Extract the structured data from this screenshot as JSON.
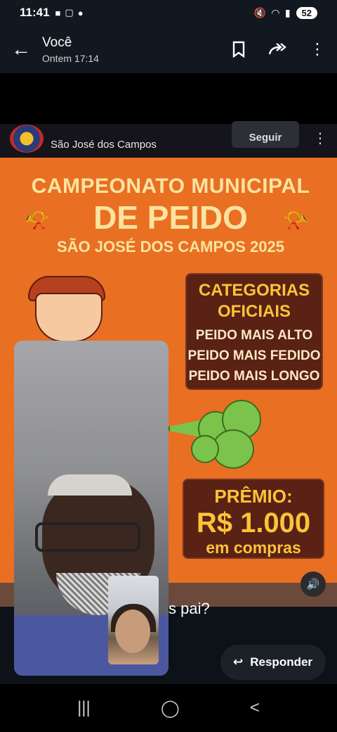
{
  "status_bar": {
    "time": "11:41",
    "battery": "52",
    "left_icons": [
      "video-icon",
      "screen-icon",
      "record-dot"
    ]
  },
  "app_bar": {
    "title": "Você",
    "subtitle": "Ontem 17:14"
  },
  "story": {
    "account_name": "São José dos Campos",
    "follow_label": "Seguir"
  },
  "poster": {
    "title_line1": "CAMPEONATO MUNICIPAL",
    "title_line2": "DE PEIDO",
    "subtitle": "SÃO JOSÉ DOS CAMPOS 2025",
    "categories_title_line1": "CATEGORIAS",
    "categories_title_line2": "OFICIAIS",
    "categories": [
      "PEIDO MAIS ALTO",
      "PEIDO MAIS FEDIDO",
      "PEIDO MAIS LONGO"
    ],
    "prize_label": "PRÊMIO:",
    "prize_value": "R$ 1.000",
    "prize_note": "em compras"
  },
  "message": {
    "partial_text": "s pai?"
  },
  "reply_button": {
    "label": "Responder"
  },
  "colors": {
    "poster_orange": "#e96f22",
    "box_brown": "#5a2115",
    "headline_cream": "#fbe3a0",
    "accent_yellow": "#fbc437"
  }
}
